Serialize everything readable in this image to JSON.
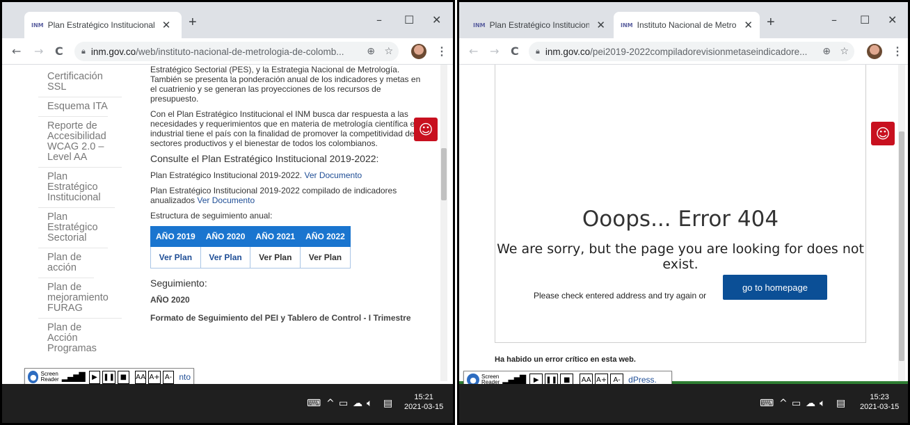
{
  "left": {
    "tab": {
      "favicon": "INM",
      "title": "Plan Estratégico Institucional",
      "close": "✕"
    },
    "newtab": "+",
    "window": {
      "minimize": "–",
      "maximize": "☐",
      "close": "✕"
    },
    "nav": {
      "back": "←",
      "forward": "→",
      "reload": "C"
    },
    "address": {
      "host": "inm.gov.co",
      "path": "/web/instituto-nacional-de-metrologia-de-colomb..."
    },
    "sidebar": [
      "Certificación SSL",
      "Esquema ITA",
      "Reporte de Accesibilidad WCAG 2.0 – Level AA",
      "Plan Estratégico Institucional",
      "Plan Estratégico Sectorial",
      "Plan de acción",
      "Plan de mejoramiento FURAG",
      "Plan de Acción Programas"
    ],
    "article": {
      "p1": "Estratégico Sectorial (PES), y la Estrategia Nacional de Metrología. También se presenta la ponderación anual de los indicadores y metas en el cuatrienio y se generan las proyecciones de los recursos de presupuesto.",
      "p2": "Con el Plan Estratégico Institucional el INM busca dar respuesta a las necesidades y requerimientos que en materia de metrología científica e industrial tiene el país con la finalidad de promover la competitividad de los sectores productivos y el bienestar de todos los colombianos.",
      "h_consult": "Consulte el Plan Estratégico Institucional 2019-2022:",
      "line1": "Plan Estratégico Institucional 2019-2022.",
      "line1_link": "Ver Documento",
      "line2": "Plan Estratégico Institucional 2019-2022 compilado de indicadores anualizados",
      "line2_link": "Ver Documento",
      "estructura": "Estructura de seguimiento anual:",
      "table_headers": [
        "AÑO 2019",
        "AÑO 2020",
        "AÑO 2021",
        "AÑO 2022"
      ],
      "table_cells": [
        "Ver Plan",
        "Ver Plan",
        "Ver Plan",
        "Ver Plan"
      ],
      "h_seguimiento": "Seguimiento:",
      "anio": "AÑO 2020",
      "formato": "Formato de Seguimiento del PEI y Tablero de Control - I Trimestre",
      "follow_link": "nto"
    },
    "clock": {
      "time": "15:21",
      "date": "2021-03-15"
    }
  },
  "right": {
    "tab1": {
      "favicon": "INM",
      "title": "Plan Estratégico Institucional",
      "close": "✕"
    },
    "tab2": {
      "favicon": "INM",
      "title": "Instituto Nacional de Metroloç",
      "close": "✕"
    },
    "newtab": "+",
    "window": {
      "minimize": "–",
      "maximize": "☐",
      "close": "✕"
    },
    "nav": {
      "back": "←",
      "forward": "→",
      "reload": "C"
    },
    "address": {
      "host": "inm.gov.co",
      "path": "/pei2019-2022compiladorevisionmetaseindicadore..."
    },
    "error": {
      "title": "Ooops... Error 404",
      "subtitle": "We are sorry, but the page you are looking for does not exist.",
      "check": "Please check entered address and try again or",
      "button": "go to homepage"
    },
    "critical": "Ha habido un error crítico en esta web.",
    "follow_link": "dPress.",
    "clock": {
      "time": "15:23",
      "date": "2021-03-15"
    }
  },
  "screen_reader": {
    "label_line1": "Screen",
    "label_line2": "Reader",
    "play": "▶",
    "pause": "❚❚",
    "stop": "■",
    "font_normal": "AA",
    "font_up": "A+",
    "font_down": "A-"
  },
  "icons": {
    "accessibility": "accessibility-icon",
    "lock": "lock-icon",
    "zoom": "zoom-icon",
    "star": "star-icon"
  },
  "colors": {
    "table_header": "#1a75cf",
    "link": "#1f4e96",
    "accessibility_button": "#c8101f",
    "home_button": "#0b4f96",
    "taskbar": "#1f1f1f"
  }
}
